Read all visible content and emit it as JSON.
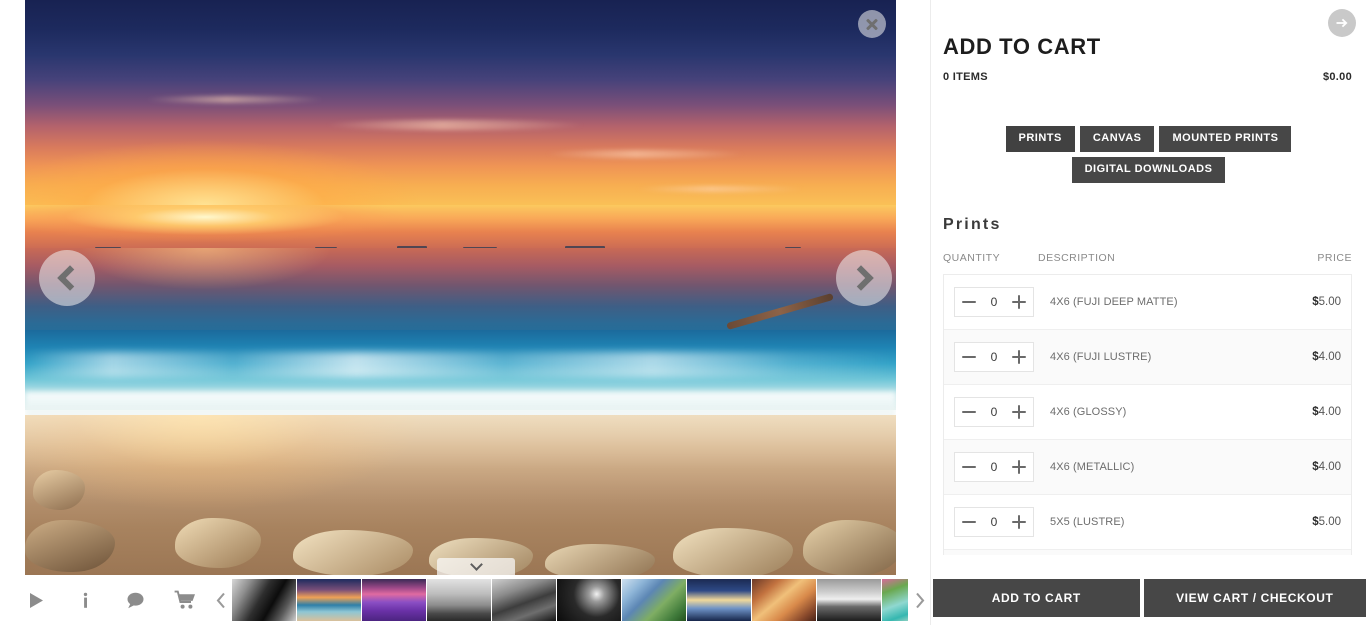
{
  "viewer": {
    "close_label": "close-icon",
    "prev_label": "previous-photo",
    "next_label": "next-photo",
    "panel_toggle_label": "toggle-panel",
    "toolbar": [
      {
        "name": "slideshow-icon",
        "label": "Slideshow"
      },
      {
        "name": "info-icon",
        "label": "Info"
      },
      {
        "name": "comment-icon",
        "label": "Comments"
      },
      {
        "name": "cart-icon",
        "label": "Cart"
      }
    ],
    "thumb_prev_label": "scroll-thumbnails-left",
    "thumb_next_label": "scroll-thumbnails-right",
    "thumbnails": [
      {
        "name": "thumb-slot-canyon-bw"
      },
      {
        "name": "thumb-beach-sunset"
      },
      {
        "name": "thumb-lavender-field"
      },
      {
        "name": "thumb-pier-bw"
      },
      {
        "name": "thumb-yosemite-bw"
      },
      {
        "name": "thumb-cave-bw"
      },
      {
        "name": "thumb-city-skyline-green"
      },
      {
        "name": "thumb-harbor-night"
      },
      {
        "name": "thumb-antelope-canyon"
      },
      {
        "name": "thumb-stormy-beach-bw"
      },
      {
        "name": "thumb-waterfall-turquoise"
      }
    ]
  },
  "cart": {
    "title": "ADD TO CART",
    "items_count": "0 ITEMS",
    "total": "$0.00",
    "next_label": "next-arrow-icon",
    "tabs": [
      {
        "label": "PRINTS",
        "active": true
      },
      {
        "label": "CANVAS",
        "active": false
      },
      {
        "label": "MOUNTED PRINTS",
        "active": false
      },
      {
        "label": "DIGITAL DOWNLOADS",
        "active": false
      }
    ],
    "section_title": "Prints",
    "columns": {
      "quantity": "QUANTITY",
      "description": "DESCRIPTION",
      "price": "PRICE"
    },
    "rows": [
      {
        "qty": "0",
        "description": "4X6 (FUJI DEEP MATTE)",
        "price_symbol": "$",
        "price_amount": "5.00"
      },
      {
        "qty": "0",
        "description": "4X6 (FUJI LUSTRE)",
        "price_symbol": "$",
        "price_amount": "4.00"
      },
      {
        "qty": "0",
        "description": "4X6 (GLOSSY)",
        "price_symbol": "$",
        "price_amount": "4.00"
      },
      {
        "qty": "0",
        "description": "4X6 (METALLIC)",
        "price_symbol": "$",
        "price_amount": "4.00"
      },
      {
        "qty": "0",
        "description": "5X5 (LUSTRE)",
        "price_symbol": "$",
        "price_amount": "5.00"
      }
    ],
    "decrement_label": "decrease-quantity",
    "increment_label": "increase-quantity",
    "actions": {
      "add_to_cart": "ADD TO CART",
      "view_cart": "VIEW CART / CHECKOUT"
    }
  },
  "colors": {
    "button_dark": "#474747",
    "panel_bg": "#ffffff",
    "row_alt": "#fafafa",
    "muted_text": "#8a8a8a"
  }
}
